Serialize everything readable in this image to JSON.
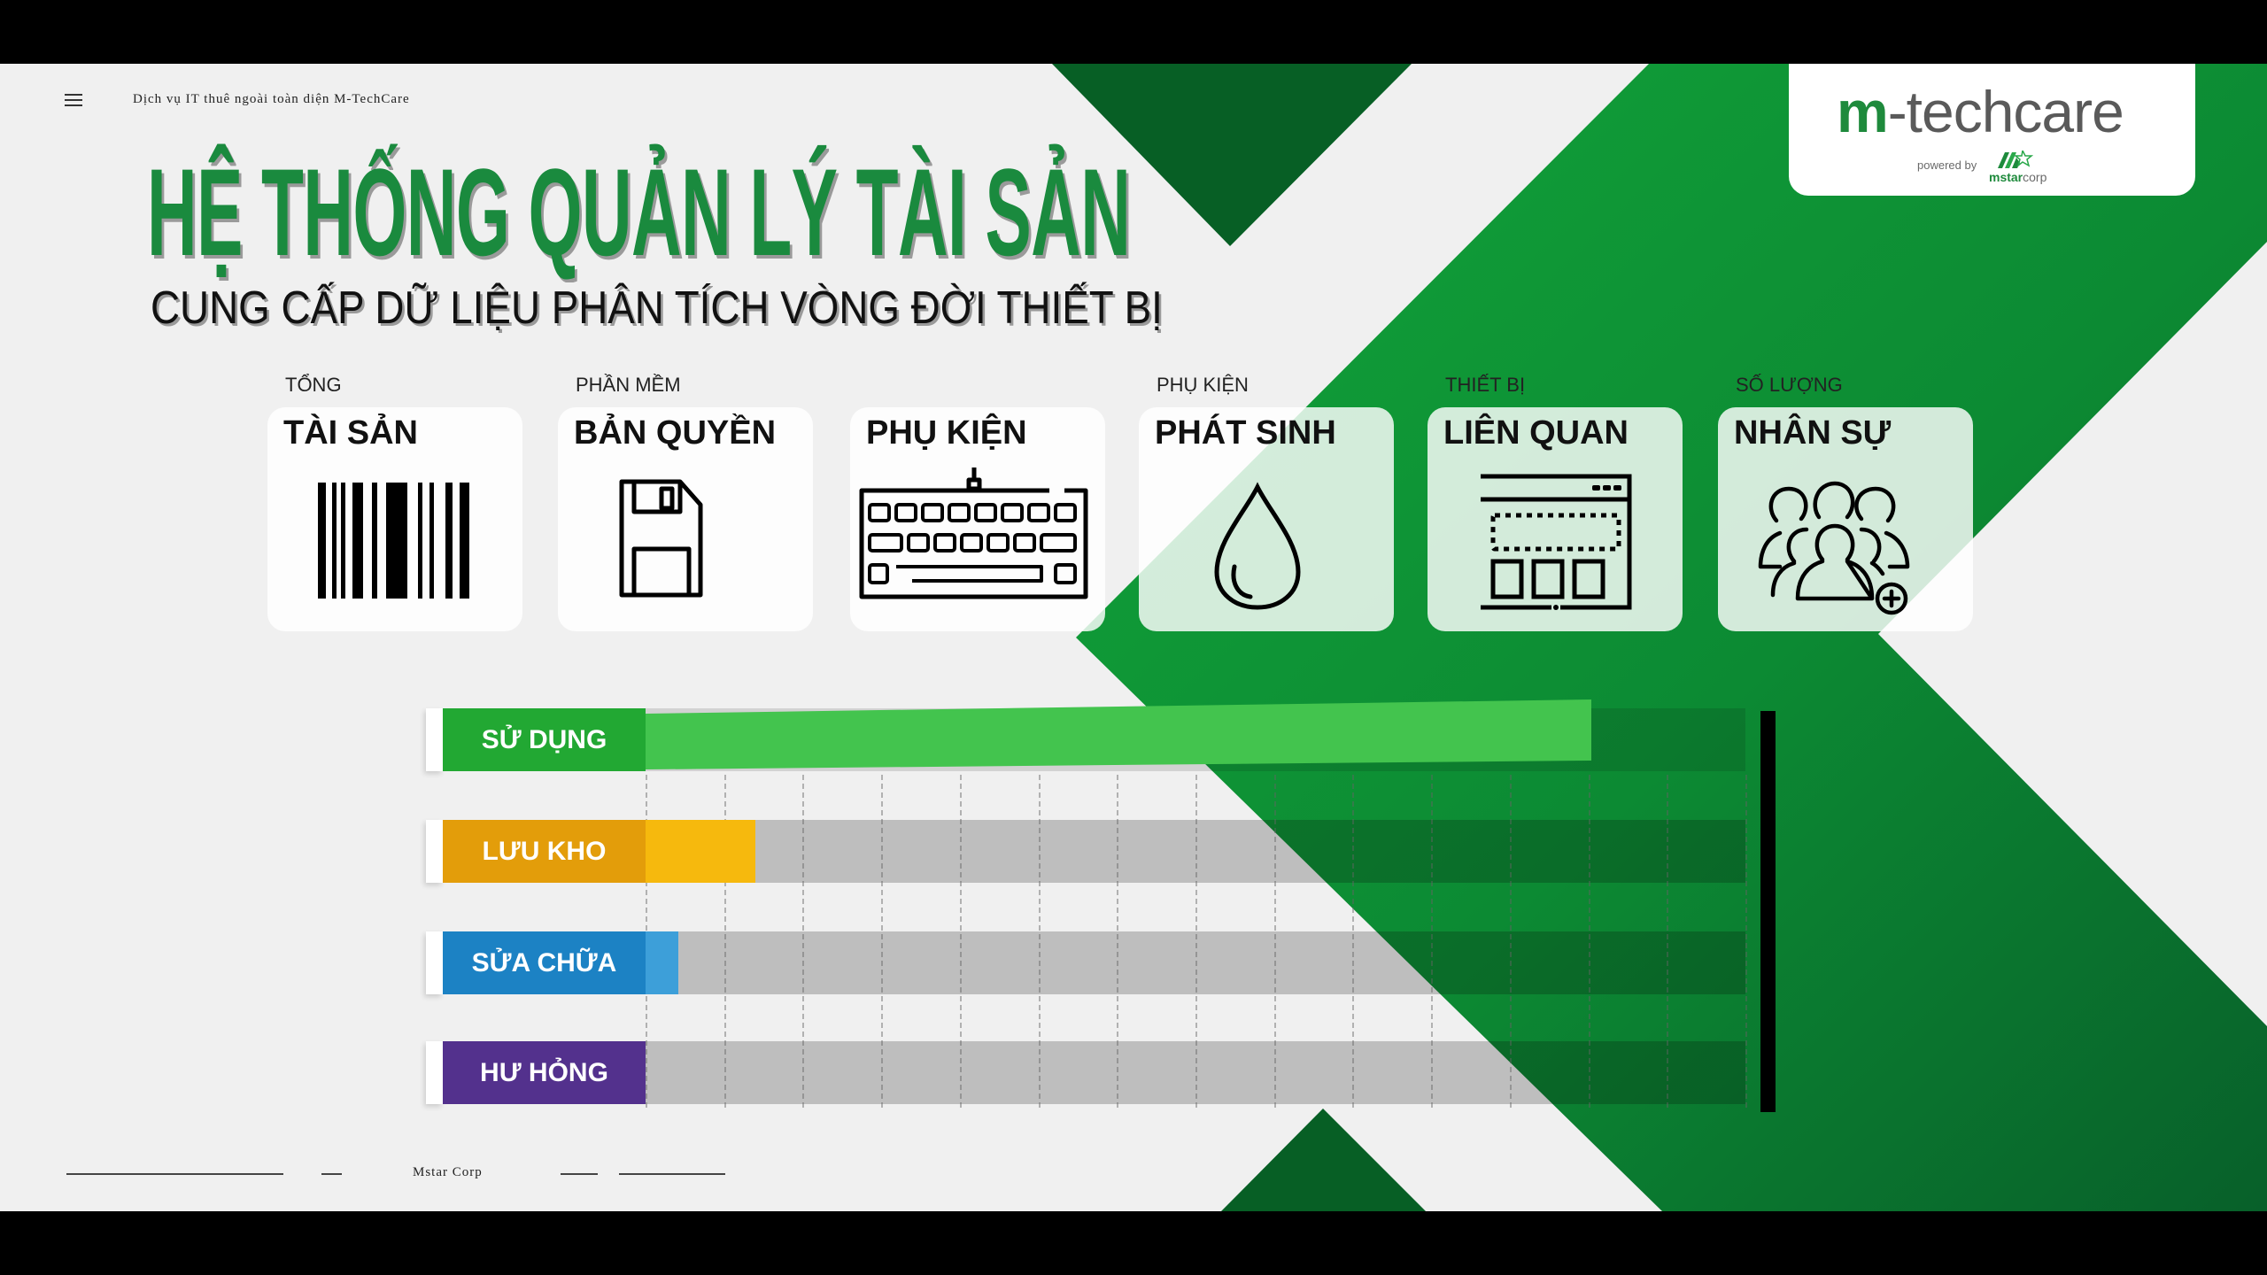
{
  "header": {
    "menu_icon": "hamburger-menu-icon",
    "tagline": "Dịch vụ IT thuê ngoài toàn diện M-TechCare"
  },
  "title": "HỆ THỐNG QUẢN LÝ TÀI SẢN",
  "subtitle": "CUNG CẤP DỮ LIỆU PHÂN TÍCH VÒNG ĐỜI THIẾT BỊ",
  "logo": {
    "brand_prefix": "m",
    "brand_rest": "-techcare",
    "powered_by": "powered by",
    "partner_bold": "mstar",
    "partner_rest": "corp"
  },
  "cards": [
    {
      "caption": "TỔNG",
      "title": "TÀI SẢN",
      "icon": "barcode-icon"
    },
    {
      "caption": "PHẦN MỀM",
      "title": "BẢN QUYỀN",
      "icon": "floppy-disk-icon"
    },
    {
      "caption": "",
      "title": "PHỤ KIỆN",
      "icon": "keyboard-icon"
    },
    {
      "caption": "PHỤ KIỆN",
      "title": "PHÁT SINH",
      "icon": "water-drop-icon"
    },
    {
      "caption": "THIẾT BỊ",
      "title": "LIÊN QUAN",
      "icon": "browser-window-icon"
    },
    {
      "caption": "SỐ LƯỢNG",
      "title": "NHÂN SỰ",
      "icon": "add-people-group-icon"
    }
  ],
  "colors": {
    "brand_green": "#1a8a3e",
    "background": "#f0f0f0",
    "track": "#cccccc"
  },
  "chart_data": {
    "type": "bar",
    "orientation": "horizontal",
    "title": "",
    "xlabel": "",
    "ylabel": "",
    "unit": "percent of total (estimated from bar length)",
    "xlim": [
      0,
      100
    ],
    "grid": true,
    "legend": "none",
    "categories": [
      "SỬ DỤNG",
      "LƯU KHO",
      "SỬA CHỮA",
      "HƯ HỎNG"
    ],
    "values": [
      86,
      10,
      3,
      0
    ],
    "series_colors": [
      {
        "label": "#22a833",
        "bar": "#43c44e"
      },
      {
        "label": "#e39d0a",
        "bar": "#f6b90d"
      },
      {
        "label": "#1c82c4",
        "bar": "#3d9fd9"
      },
      {
        "label": "#53318d",
        "bar": "#53318d"
      }
    ],
    "gridline_count": 14
  },
  "footer": {
    "company": "Mstar Corp"
  }
}
